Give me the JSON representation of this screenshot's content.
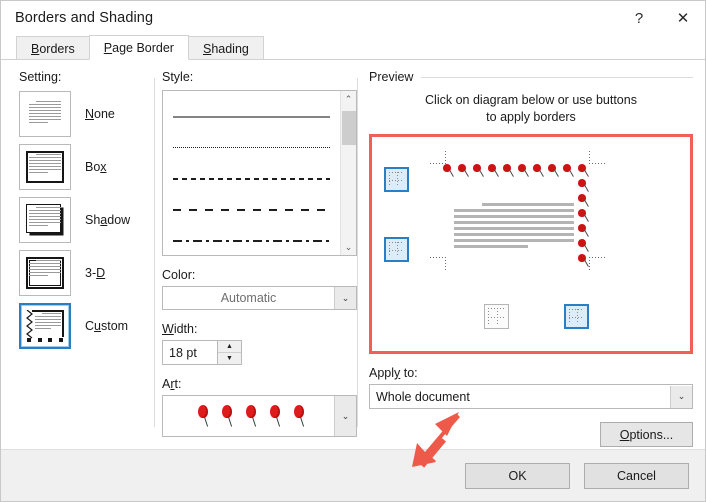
{
  "window": {
    "title": "Borders and Shading",
    "help_label": "?",
    "close_label": "✕"
  },
  "tabs": [
    {
      "label": "Borders",
      "mnemonic": "B",
      "active": false
    },
    {
      "label": "Page Border",
      "mnemonic": "P",
      "active": true
    },
    {
      "label": "Shading",
      "mnemonic": "S",
      "active": false
    }
  ],
  "setting": {
    "label": "Setting:",
    "options": [
      {
        "label": "None",
        "mnemonic": "N",
        "selected": false
      },
      {
        "label": "Box",
        "mnemonic": "x",
        "selected": false
      },
      {
        "label": "Shadow",
        "mnemonic": "a",
        "selected": false
      },
      {
        "label": "3-D",
        "mnemonic": "D",
        "selected": false
      },
      {
        "label": "Custom",
        "mnemonic": "u",
        "selected": true
      }
    ]
  },
  "style": {
    "label": "Style:",
    "items": [
      {
        "name": "solid-line",
        "kind": "solid"
      },
      {
        "name": "dotted-line",
        "kind": "dotted"
      },
      {
        "name": "dashed-line",
        "kind": "dashed"
      },
      {
        "name": "long-dashed-line",
        "kind": "long-dash"
      },
      {
        "name": "dash-dot-line",
        "kind": "dash-dot"
      }
    ],
    "scroll_up_icon": "⌃",
    "scroll_down_icon": "⌄"
  },
  "color": {
    "label": "Color:",
    "value": "Automatic",
    "dropdown_icon": "⌄",
    "disabled": true
  },
  "width": {
    "label": "Width:",
    "mnemonic": "W",
    "value": "18 pt",
    "increment_icon": "▲",
    "decrement_icon": "▼"
  },
  "art": {
    "label": "Art:",
    "mnemonic": "r",
    "value": "red-balloons",
    "balloon_count": 5,
    "dropdown_icon": "⌄"
  },
  "preview": {
    "label": "Preview",
    "instruction_line1": "Click on diagram below or use buttons",
    "instruction_line2": "to apply borders",
    "highlight_color": "#ef6156",
    "toggle_buttons": [
      {
        "name": "top-border-toggle",
        "position": "left-top",
        "active": true
      },
      {
        "name": "bottom-border-toggle",
        "position": "left-bottom",
        "active": true
      },
      {
        "name": "left-border-toggle",
        "position": "bottom-left",
        "active": false
      },
      {
        "name": "right-border-toggle",
        "position": "bottom-right",
        "active": true
      }
    ],
    "art_border_color": "#cf1313",
    "text_line_count": 8
  },
  "apply_to": {
    "label": "Apply to:",
    "mnemonic": "y",
    "value": "Whole document",
    "dropdown_icon": "⌄"
  },
  "options_button": {
    "label": "Options...",
    "mnemonic": "O"
  },
  "footer": {
    "ok_label": "OK",
    "cancel_label": "Cancel"
  },
  "annotation": {
    "arrow_color": "#ee5a4a",
    "points_at": "apply-to-dropdown"
  }
}
